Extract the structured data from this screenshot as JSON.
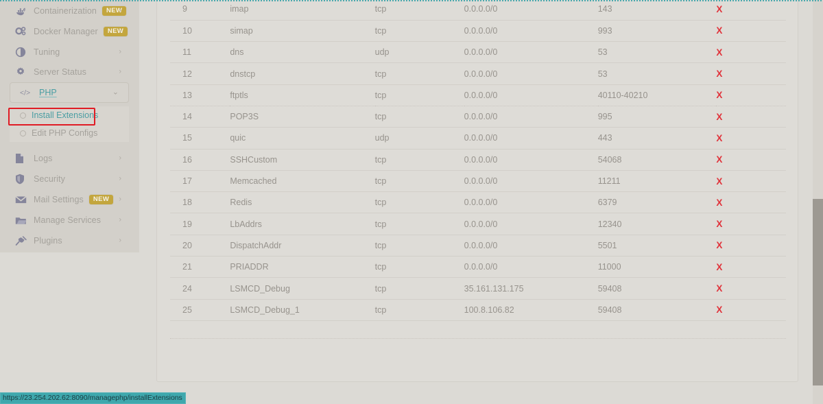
{
  "status_bar": {
    "url": "https://23.254.202.62:8090/managephp/installExtensions"
  },
  "sidebar": {
    "items": [
      {
        "label": "Containerization",
        "icon": "whale-icon",
        "badge": "NEW",
        "chevron": "›"
      },
      {
        "label": "Docker Manager",
        "icon": "gears-icon",
        "badge": "NEW",
        "chevron": "›"
      },
      {
        "label": "Tuning",
        "icon": "contrast-icon",
        "badge": "",
        "chevron": "›"
      },
      {
        "label": "Server Status",
        "icon": "gear-icon",
        "badge": "",
        "chevron": "›"
      },
      {
        "label": "Logs",
        "icon": "document-icon",
        "badge": "",
        "chevron": "›"
      },
      {
        "label": "Security",
        "icon": "shield-icon",
        "badge": "",
        "chevron": "›"
      },
      {
        "label": "Mail Settings",
        "icon": "envelope-icon",
        "badge": "NEW",
        "chevron": "›"
      },
      {
        "label": "Manage Services",
        "icon": "folder-icon",
        "badge": "",
        "chevron": "›"
      },
      {
        "label": "Plugins",
        "icon": "plug-icon",
        "badge": "",
        "chevron": "›"
      }
    ],
    "php_group": {
      "label": "PHP",
      "icon": "code-icon",
      "chevron": "⌄",
      "sub_items": [
        {
          "label": "Install Extensions",
          "icon": "radio-dot-icon",
          "highlighted": true
        },
        {
          "label": "Edit PHP Configs",
          "icon": "radio-dot-icon",
          "highlighted": false
        }
      ]
    },
    "colors": {
      "accent_teal": "#4a9ea3",
      "badge_gold": "#c3a63e",
      "highlight_red": "#e01b24",
      "panel_bg": "#d3d0ca"
    }
  },
  "main": {
    "table": {
      "delete_label": "X",
      "rows": [
        {
          "id": "9",
          "name": "imap",
          "protocol": "tcp",
          "cidr": "0.0.0.0/0",
          "port": "143"
        },
        {
          "id": "10",
          "name": "simap",
          "protocol": "tcp",
          "cidr": "0.0.0.0/0",
          "port": "993"
        },
        {
          "id": "11",
          "name": "dns",
          "protocol": "udp",
          "cidr": "0.0.0.0/0",
          "port": "53"
        },
        {
          "id": "12",
          "name": "dnstcp",
          "protocol": "tcp",
          "cidr": "0.0.0.0/0",
          "port": "53"
        },
        {
          "id": "13",
          "name": "ftptls",
          "protocol": "tcp",
          "cidr": "0.0.0.0/0",
          "port": "40110-40210"
        },
        {
          "id": "14",
          "name": "POP3S",
          "protocol": "tcp",
          "cidr": "0.0.0.0/0",
          "port": "995"
        },
        {
          "id": "15",
          "name": "quic",
          "protocol": "udp",
          "cidr": "0.0.0.0/0",
          "port": "443"
        },
        {
          "id": "16",
          "name": "SSHCustom",
          "protocol": "tcp",
          "cidr": "0.0.0.0/0",
          "port": "54068"
        },
        {
          "id": "17",
          "name": "Memcached",
          "protocol": "tcp",
          "cidr": "0.0.0.0/0",
          "port": "11211"
        },
        {
          "id": "18",
          "name": "Redis",
          "protocol": "tcp",
          "cidr": "0.0.0.0/0",
          "port": "6379"
        },
        {
          "id": "19",
          "name": "LbAddrs",
          "protocol": "tcp",
          "cidr": "0.0.0.0/0",
          "port": "12340"
        },
        {
          "id": "20",
          "name": "DispatchAddr",
          "protocol": "tcp",
          "cidr": "0.0.0.0/0",
          "port": "5501"
        },
        {
          "id": "21",
          "name": "PRIADDR",
          "protocol": "tcp",
          "cidr": "0.0.0.0/0",
          "port": "11000"
        },
        {
          "id": "24",
          "name": "LSMCD_Debug",
          "protocol": "tcp",
          "cidr": "35.161.131.175",
          "port": "59408"
        },
        {
          "id": "25",
          "name": "LSMCD_Debug_1",
          "protocol": "tcp",
          "cidr": "100.8.106.82",
          "port": "59408"
        }
      ]
    }
  }
}
